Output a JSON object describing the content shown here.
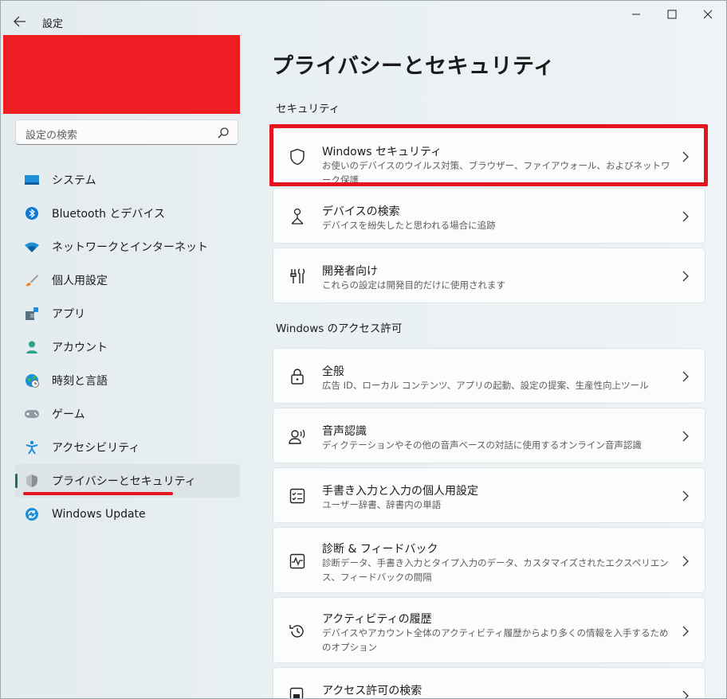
{
  "app": {
    "title": "設定"
  },
  "sidebar": {
    "search": {
      "placeholder": "設定の検索"
    },
    "items": [
      {
        "label": "システム",
        "icon": "monitor-icon"
      },
      {
        "label": "Bluetooth とデバイス",
        "icon": "bluetooth-icon"
      },
      {
        "label": "ネットワークとインターネット",
        "icon": "wifi-icon"
      },
      {
        "label": "個人用設定",
        "icon": "paintbrush-icon"
      },
      {
        "label": "アプリ",
        "icon": "apps-icon"
      },
      {
        "label": "アカウント",
        "icon": "person-icon"
      },
      {
        "label": "時刻と言語",
        "icon": "globe-clock-icon"
      },
      {
        "label": "ゲーム",
        "icon": "gamepad-icon"
      },
      {
        "label": "アクセシビリティ",
        "icon": "accessibility-icon"
      },
      {
        "label": "プライバシーとセキュリティ",
        "icon": "shield-icon",
        "active": true
      },
      {
        "label": "Windows Update",
        "icon": "update-icon"
      }
    ]
  },
  "main": {
    "title": "プライバシーとセキュリティ",
    "sections": [
      {
        "label": "セキュリティ",
        "cards": [
          {
            "title": "Windows セキュリティ",
            "desc": "お使いのデバイスのウイルス対策、ブラウザー、ファイアウォール、およびネットワーク保護",
            "icon": "shield-outline-icon"
          },
          {
            "title": "デバイスの検索",
            "desc": "デバイスを紛失したと思われる場合に追跡",
            "icon": "person-pin-icon"
          },
          {
            "title": "開発者向け",
            "desc": "これらの設定は開発目的だけに使用されます",
            "icon": "developer-tools-icon"
          }
        ]
      },
      {
        "label": "Windows のアクセス許可",
        "cards": [
          {
            "title": "全般",
            "desc": "広告 ID、ローカル コンテンツ、アプリの起動、設定の提案、生産性向上ツール",
            "icon": "lock-icon"
          },
          {
            "title": "音声認識",
            "desc": "ディクテーションやその他の音声ベースの対話に使用するオンライン音声認識",
            "icon": "speech-icon"
          },
          {
            "title": "手書き入力と入力の個人用設定",
            "desc": "ユーザー辞書、辞書内の単語",
            "icon": "checklist-icon"
          },
          {
            "title": "診断 & フィードバック",
            "desc": "診断データ、手書き入力とタイプ入力のデータ、カスタマイズされたエクスペリエンス、フィードバックの間隔",
            "icon": "pulse-icon"
          },
          {
            "title": "アクティビティの履歴",
            "desc": "デバイスやアカウント全体のアクティビティ履歴からより多くの情報を入手するためのオプション",
            "icon": "history-icon"
          },
          {
            "title": "アクセス許可の検索",
            "desc": "",
            "icon": "search-permission-icon"
          }
        ]
      }
    ]
  },
  "colors": {
    "accent": "#1f6e5a",
    "highlight": "#e4141e",
    "redaction": "#ee1d23"
  }
}
